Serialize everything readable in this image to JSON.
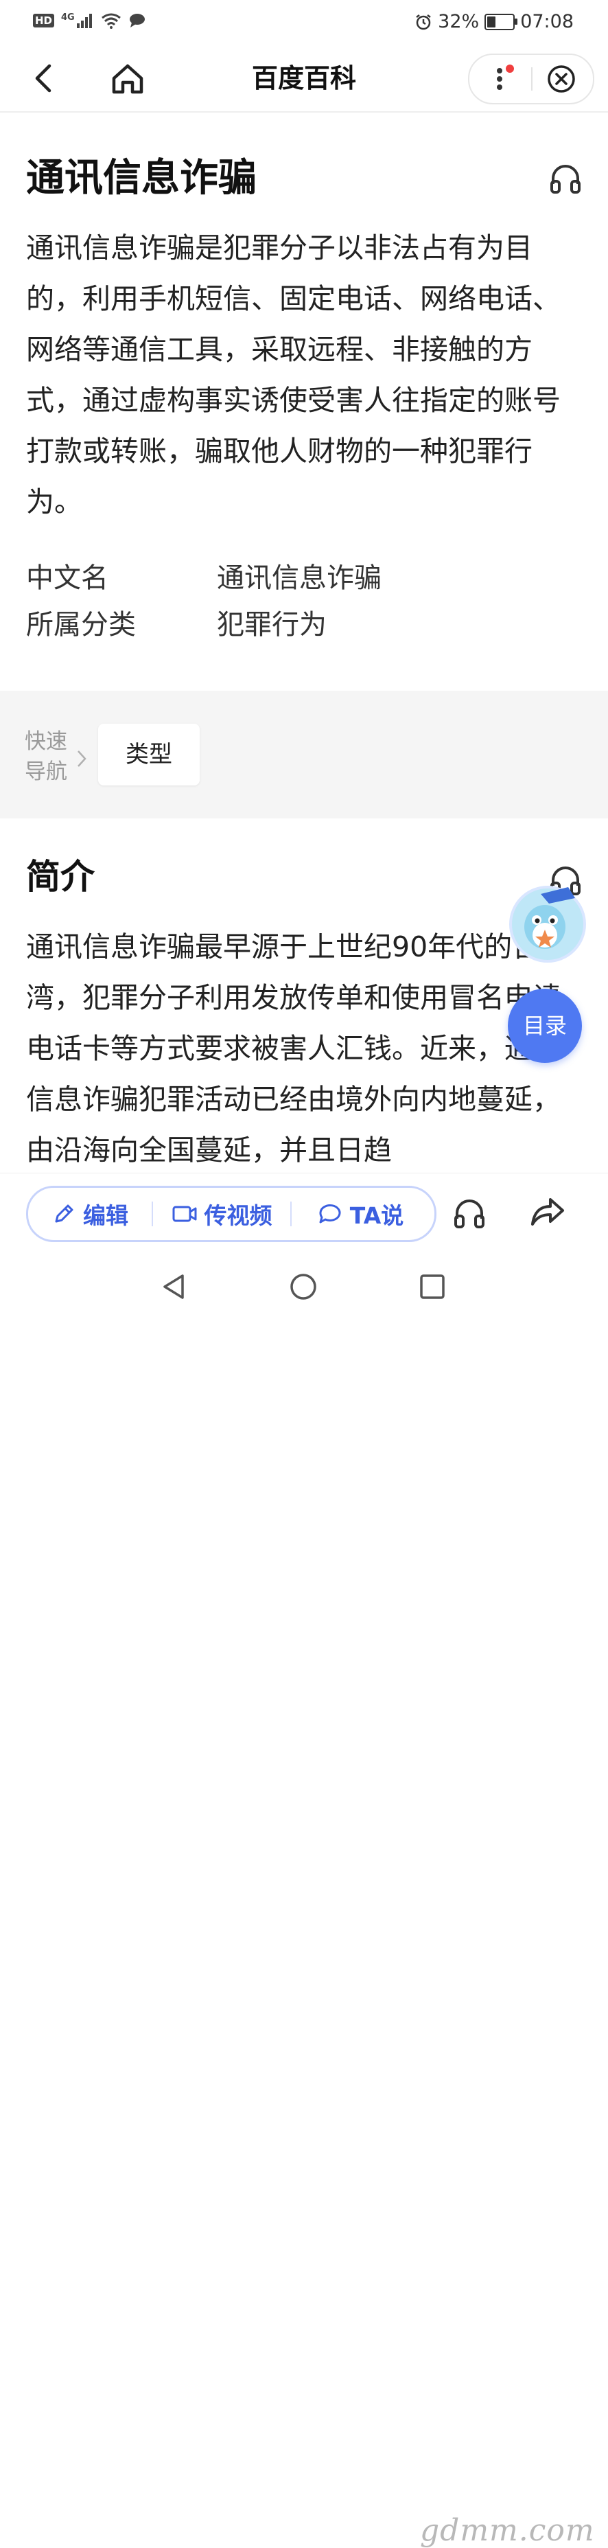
{
  "status_bar": {
    "left_badges": [
      "HD",
      "4G"
    ],
    "battery": "32%",
    "battery_level": 0.32,
    "time": "07:08"
  },
  "nav": {
    "title": "百度百科"
  },
  "article": {
    "title": "通讯信息诈骗",
    "summary": "通讯信息诈骗是犯罪分子以非法占有为目的，利用手机短信、固定电话、网络电话、网络等通信工具，采取远程、非接触的方式，通过虚构事实诱使受害人往指定的账号打款或转账，骗取他人财物的一种犯罪行为。",
    "infobox": [
      {
        "key": "中文名",
        "value": "通讯信息诈骗"
      },
      {
        "key": "所属分类",
        "value": "犯罪行为"
      }
    ]
  },
  "quick_nav": {
    "label_line1": "快速",
    "label_line2": "导航",
    "items": [
      "类型"
    ]
  },
  "intro_section": {
    "title": "简介",
    "text": "通讯信息诈骗最早源于上世纪90年代的台湾，犯罪分子利用发放传单和使用冒名申请电话卡等方式要求被害人汇钱。近来，通讯信息诈骗犯罪活动已经由境外向内地蔓延，由沿海向全国蔓延，并且日趋"
  },
  "toc_button": {
    "label": "目录"
  },
  "action_bar": {
    "edit": "编辑",
    "upload_video": "传视频",
    "ta_say": "TA说"
  },
  "watermark": "gdmm.com",
  "colors": {
    "accent": "#4f79f2",
    "accent_text": "#3b5fe0",
    "quicknav_bg": "#f5f5f5",
    "red_dot": "#f03e3e"
  },
  "icons": [
    "back-icon",
    "home-icon",
    "more-icon",
    "close-icon",
    "headphones-icon",
    "chevron-right-icon",
    "pencil-icon",
    "video-icon",
    "chat-icon",
    "share-icon"
  ]
}
